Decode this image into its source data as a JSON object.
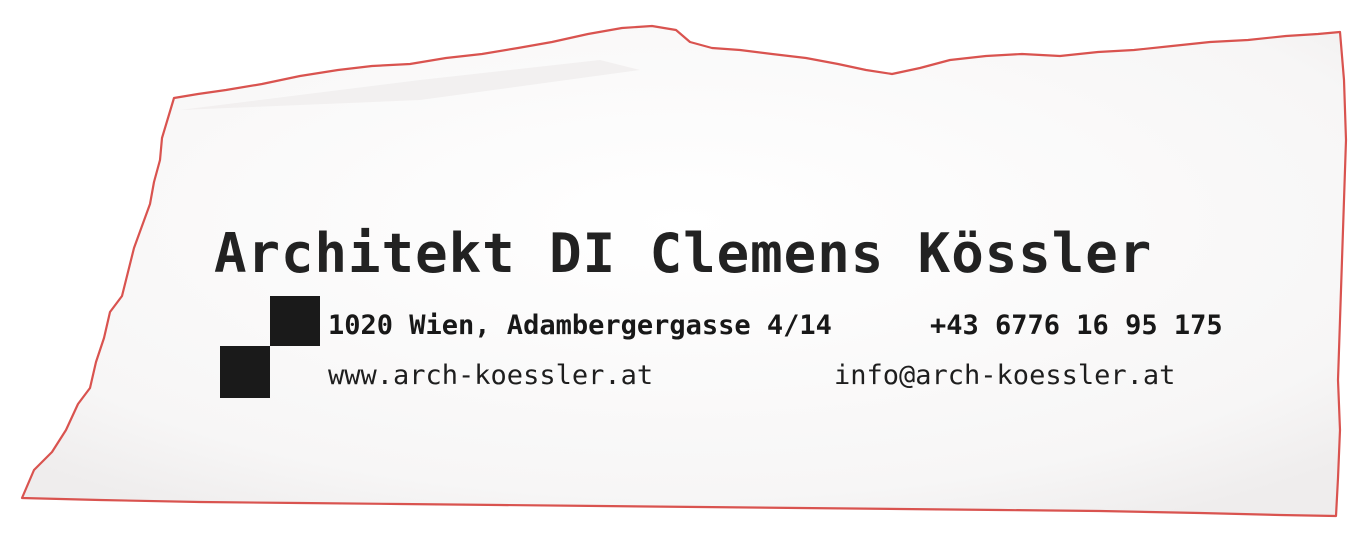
{
  "card": {
    "title": "Architekt DI Clemens Kössler",
    "address": "1020 Wien, Adambergergasse 4/14",
    "phone": "+43 6776 16 95 175",
    "website": "www.arch-koessler.at",
    "email": "info@arch-koessler.at"
  },
  "logo": {
    "icon": "checker-squares-logo",
    "ink_color": "#1a1a1a"
  },
  "colors": {
    "paper": "#fbfbfb",
    "torn_edge": "#d9534f",
    "ink": "#1c1c1c"
  }
}
